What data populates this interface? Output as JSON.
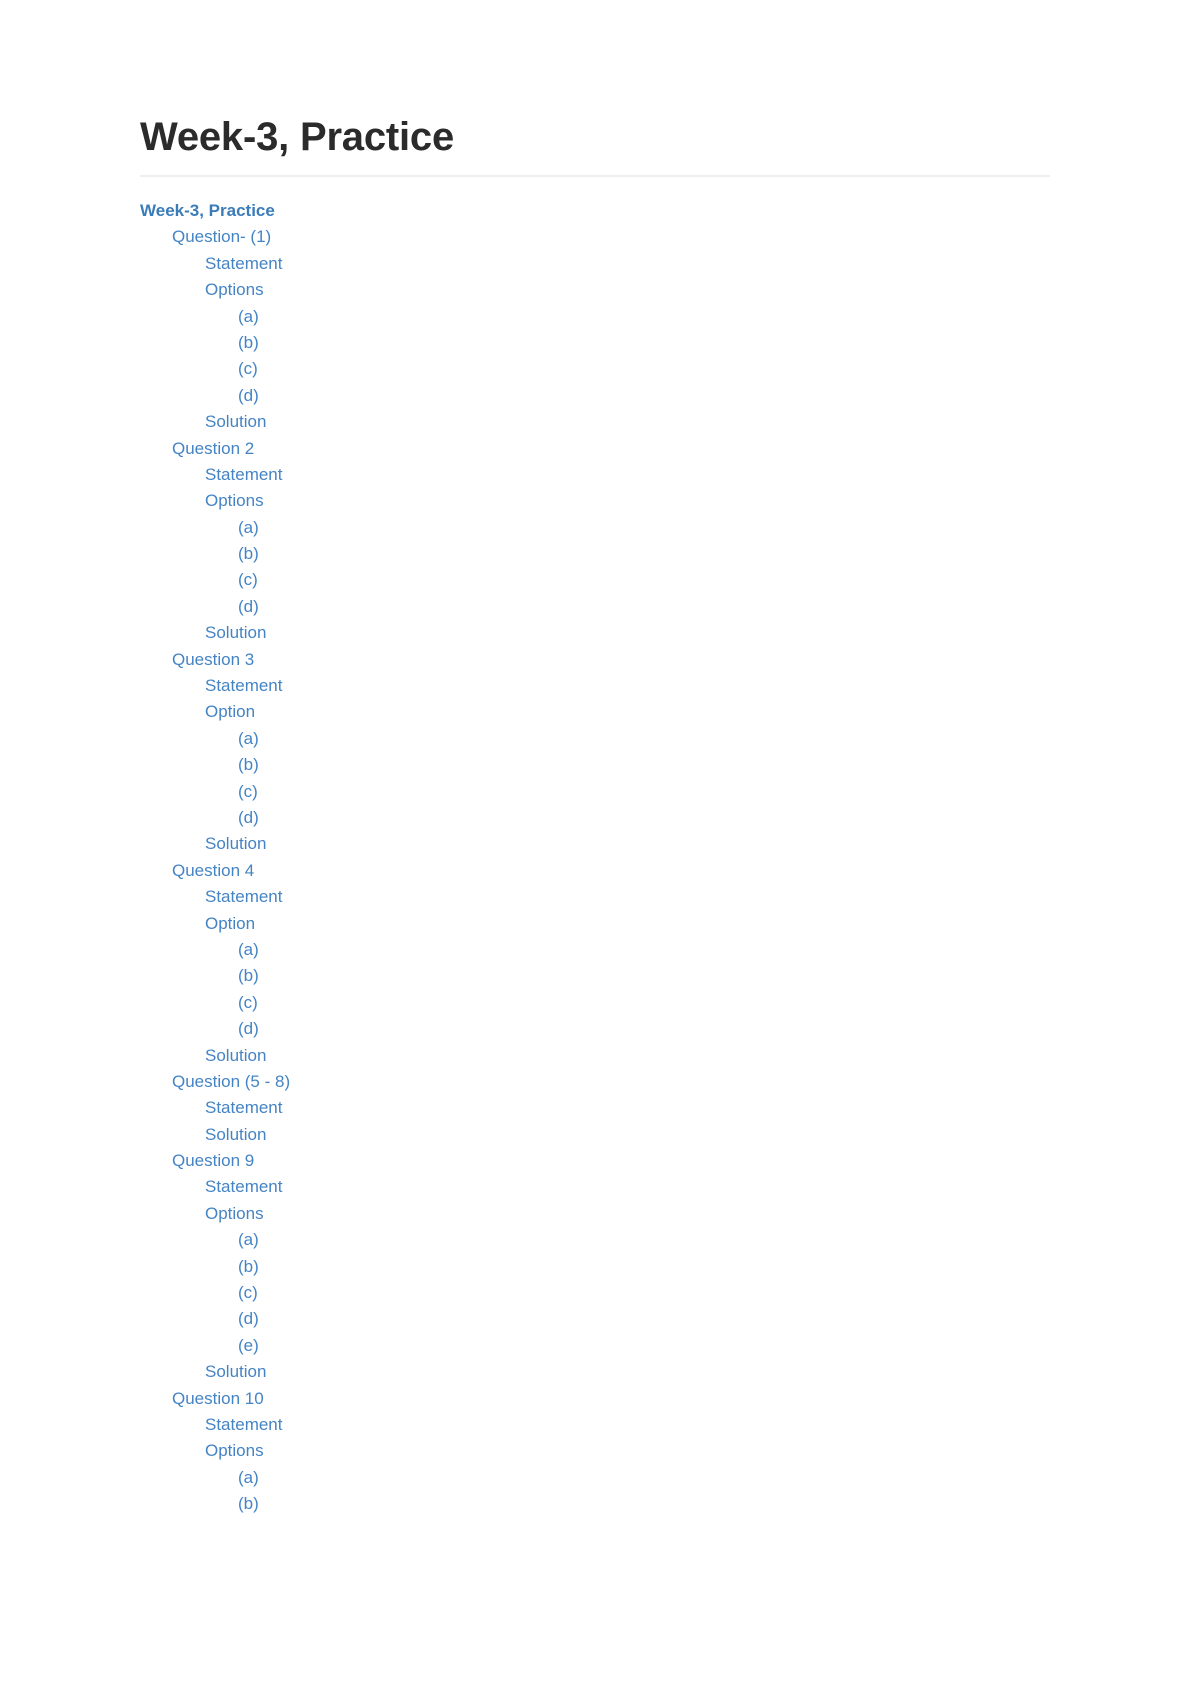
{
  "document": {
    "title": "Week-3, Practice"
  },
  "theme": {
    "title_color": "#2b2b2b",
    "link_color": "#4484c4",
    "root_link_color": "#3b7cb8",
    "rule_color": "#eeeeee",
    "background": "#ffffff"
  },
  "toc": {
    "entries": [
      {
        "label": "Week-3, Practice",
        "level": 0
      },
      {
        "label": "Question- (1)",
        "level": 1
      },
      {
        "label": "Statement",
        "level": 2
      },
      {
        "label": "Options",
        "level": 2
      },
      {
        "label": "(a)",
        "level": 3
      },
      {
        "label": "(b)",
        "level": 3
      },
      {
        "label": "(c)",
        "level": 3
      },
      {
        "label": "(d)",
        "level": 3
      },
      {
        "label": "Solution",
        "level": 2
      },
      {
        "label": "Question 2",
        "level": 1
      },
      {
        "label": "Statement",
        "level": 2
      },
      {
        "label": "Options",
        "level": 2
      },
      {
        "label": "(a)",
        "level": 3
      },
      {
        "label": "(b)",
        "level": 3
      },
      {
        "label": "(c)",
        "level": 3
      },
      {
        "label": "(d)",
        "level": 3
      },
      {
        "label": "Solution",
        "level": 2
      },
      {
        "label": "Question 3",
        "level": 1
      },
      {
        "label": "Statement",
        "level": 2
      },
      {
        "label": "Option",
        "level": 2
      },
      {
        "label": "(a)",
        "level": 3
      },
      {
        "label": "(b)",
        "level": 3
      },
      {
        "label": "(c)",
        "level": 3
      },
      {
        "label": "(d)",
        "level": 3
      },
      {
        "label": "Solution",
        "level": 2
      },
      {
        "label": "Question 4",
        "level": 1
      },
      {
        "label": "Statement",
        "level": 2
      },
      {
        "label": "Option",
        "level": 2
      },
      {
        "label": "(a)",
        "level": 3
      },
      {
        "label": "(b)",
        "level": 3
      },
      {
        "label": "(c)",
        "level": 3
      },
      {
        "label": "(d)",
        "level": 3
      },
      {
        "label": "Solution",
        "level": 2
      },
      {
        "label": "Question (5 - 8)",
        "level": 1
      },
      {
        "label": "Statement",
        "level": 2
      },
      {
        "label": "Solution",
        "level": 2
      },
      {
        "label": "Question 9",
        "level": 1
      },
      {
        "label": "Statement",
        "level": 2
      },
      {
        "label": "Options",
        "level": 2
      },
      {
        "label": "(a)",
        "level": 3
      },
      {
        "label": "(b)",
        "level": 3
      },
      {
        "label": "(c)",
        "level": 3
      },
      {
        "label": "(d)",
        "level": 3
      },
      {
        "label": "(e)",
        "level": 3
      },
      {
        "label": "Solution",
        "level": 2
      },
      {
        "label": "Question 10",
        "level": 1
      },
      {
        "label": "Statement",
        "level": 2
      },
      {
        "label": "Options",
        "level": 2
      },
      {
        "label": "(a)",
        "level": 3
      },
      {
        "label": "(b)",
        "level": 3
      }
    ]
  }
}
